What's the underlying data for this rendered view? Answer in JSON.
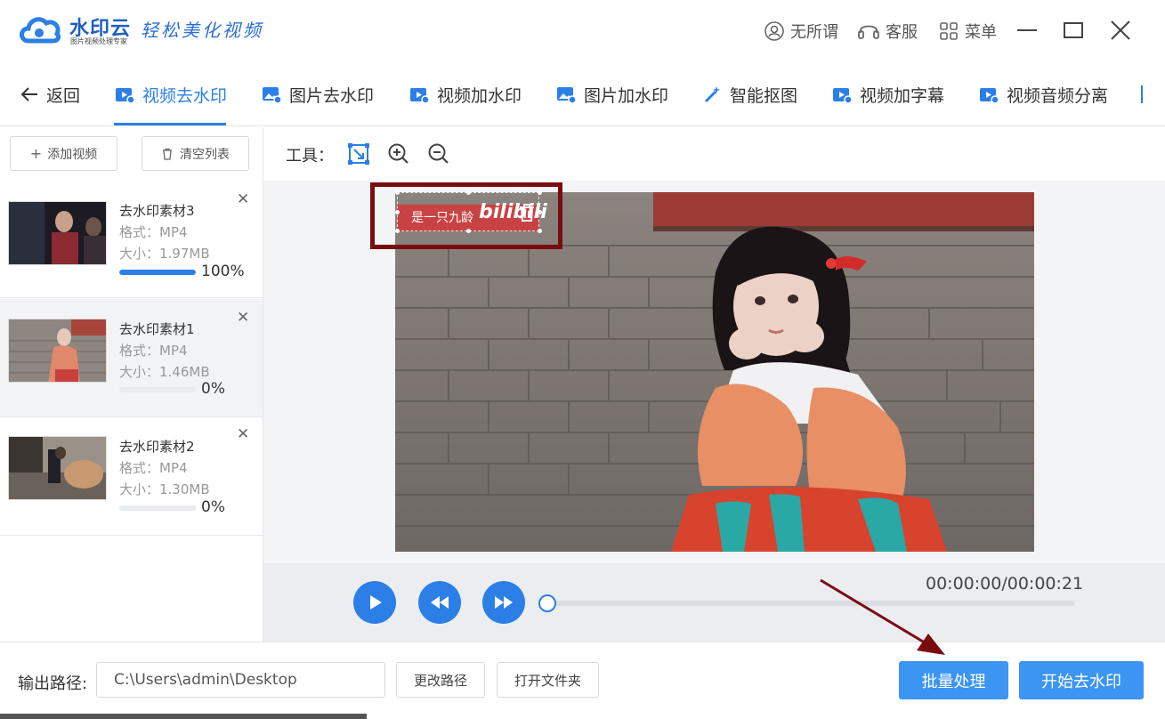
{
  "app": {
    "brand_name": "水印云",
    "brand_sub": "图片视频处理专家",
    "slogan": "轻松美化视频",
    "user_label": "无所谓",
    "service_label": "客服",
    "menu_label": "菜单"
  },
  "nav": {
    "back_label": "返回",
    "tabs": [
      {
        "label": "视频去水印",
        "icon": "video-icon",
        "active": true
      },
      {
        "label": "图片去水印",
        "icon": "image-icon",
        "active": false
      },
      {
        "label": "视频加水印",
        "icon": "video-add-icon",
        "active": false
      },
      {
        "label": "图片加水印",
        "icon": "image-add-icon",
        "active": false
      },
      {
        "label": "智能抠图",
        "icon": "magic-wand-icon",
        "active": false
      },
      {
        "label": "视频加字幕",
        "icon": "subtitle-icon",
        "active": false
      },
      {
        "label": "视频音频分离",
        "icon": "audio-split-icon",
        "active": false
      }
    ]
  },
  "left": {
    "add_video_label": "添加视频",
    "clear_list_label": "清空列表",
    "files": [
      {
        "name": "去水印素材3",
        "format": "格式：MP4",
        "size": "大小：1.97MB",
        "percent": "100%",
        "progress": 1.0,
        "selected": false
      },
      {
        "name": "去水印素材1",
        "format": "格式：MP4",
        "size": "大小：1.46MB",
        "percent": "0%",
        "progress": 0.0,
        "selected": true
      },
      {
        "name": "去水印素材2",
        "format": "格式：MP4",
        "size": "大小：1.30MB",
        "percent": "0%",
        "progress": 0.0,
        "selected": false
      }
    ]
  },
  "tools": {
    "label": "工具："
  },
  "watermark": {
    "text": "是一只九龄",
    "logo": "bilibili"
  },
  "player": {
    "timecode": "00:00:00/00:00:21",
    "progress": 0.0
  },
  "bottom": {
    "output_label": "输出路径:",
    "output_path": "C:\\Users\\admin\\Desktop",
    "change_path_label": "更改路径",
    "open_folder_label": "打开文件夹",
    "batch_label": "批量处理",
    "start_label": "开始去水印"
  },
  "colors": {
    "accent": "#2b7fe6",
    "primary_button": "#3c95f2",
    "annotation": "#7a0c10"
  }
}
